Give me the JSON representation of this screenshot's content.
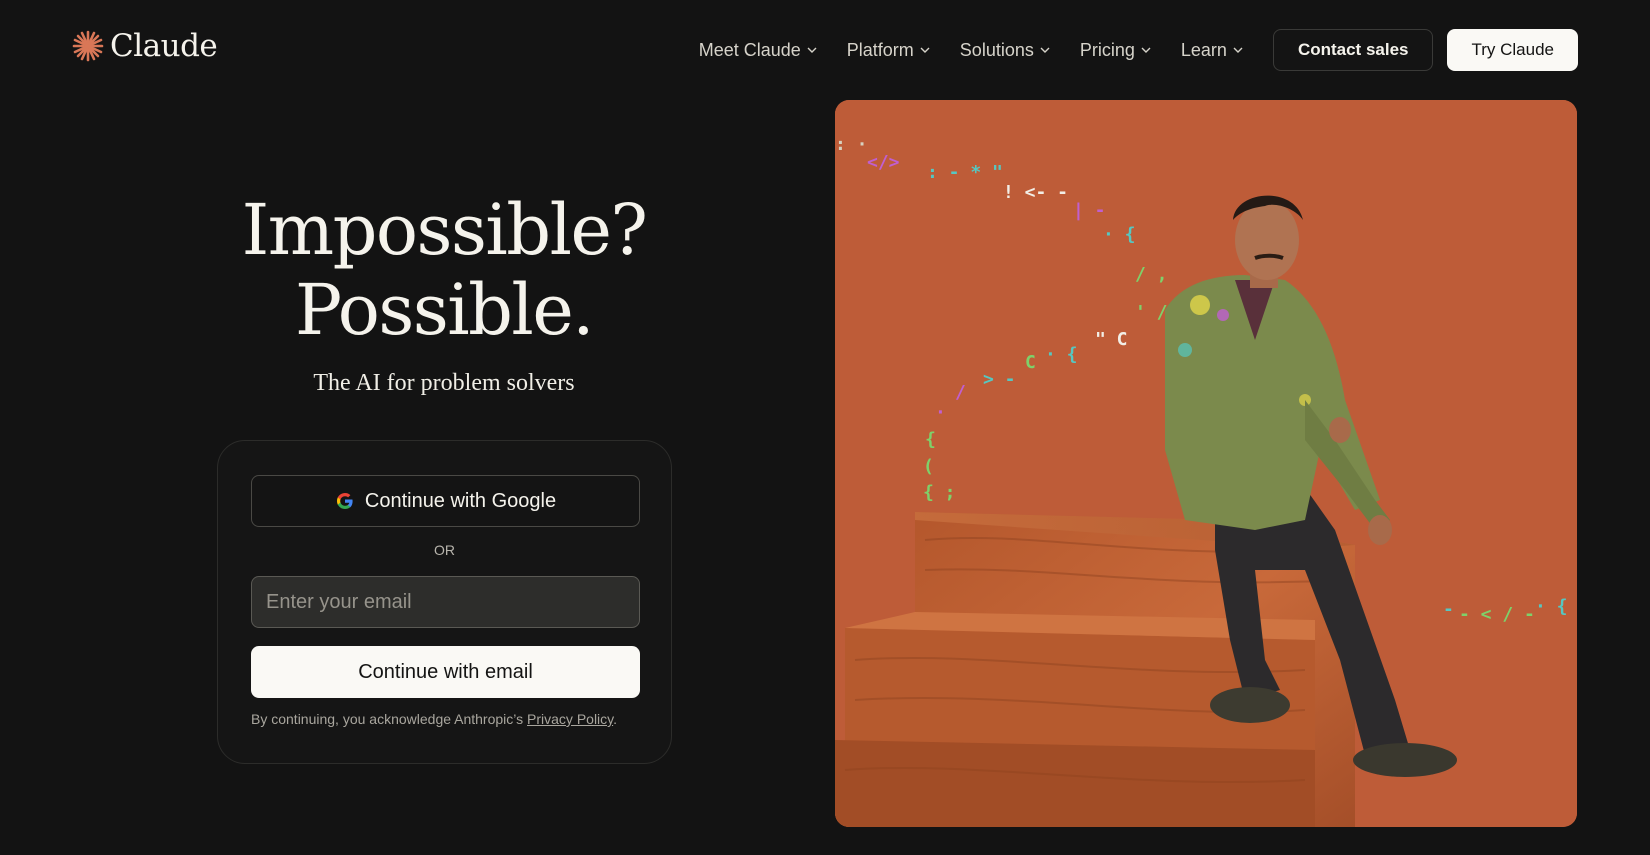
{
  "brand": {
    "name": "Claude",
    "logo_icon": "starburst-icon",
    "accent": "#d97757"
  },
  "nav": {
    "items": [
      {
        "label": "Meet Claude"
      },
      {
        "label": "Platform"
      },
      {
        "label": "Solutions"
      },
      {
        "label": "Pricing"
      },
      {
        "label": "Learn"
      }
    ],
    "contact_label": "Contact sales",
    "try_label": "Try Claude"
  },
  "hero": {
    "title_line1": "Impossible?",
    "title_line2": "Possible.",
    "subtitle": "The AI for problem solvers"
  },
  "login": {
    "google_label": "Continue with Google",
    "or_label": "OR",
    "email_placeholder": "Enter your email",
    "email_value": "",
    "email_button_label": "Continue with email",
    "disclaimer_prefix": "By continuing, you acknowledge Anthropic’s ",
    "privacy_link_label": "Privacy Policy",
    "disclaimer_suffix": "."
  },
  "colors": {
    "background": "#131313",
    "photo_background": "#be5c38",
    "primary_button": "#faf9f5"
  }
}
